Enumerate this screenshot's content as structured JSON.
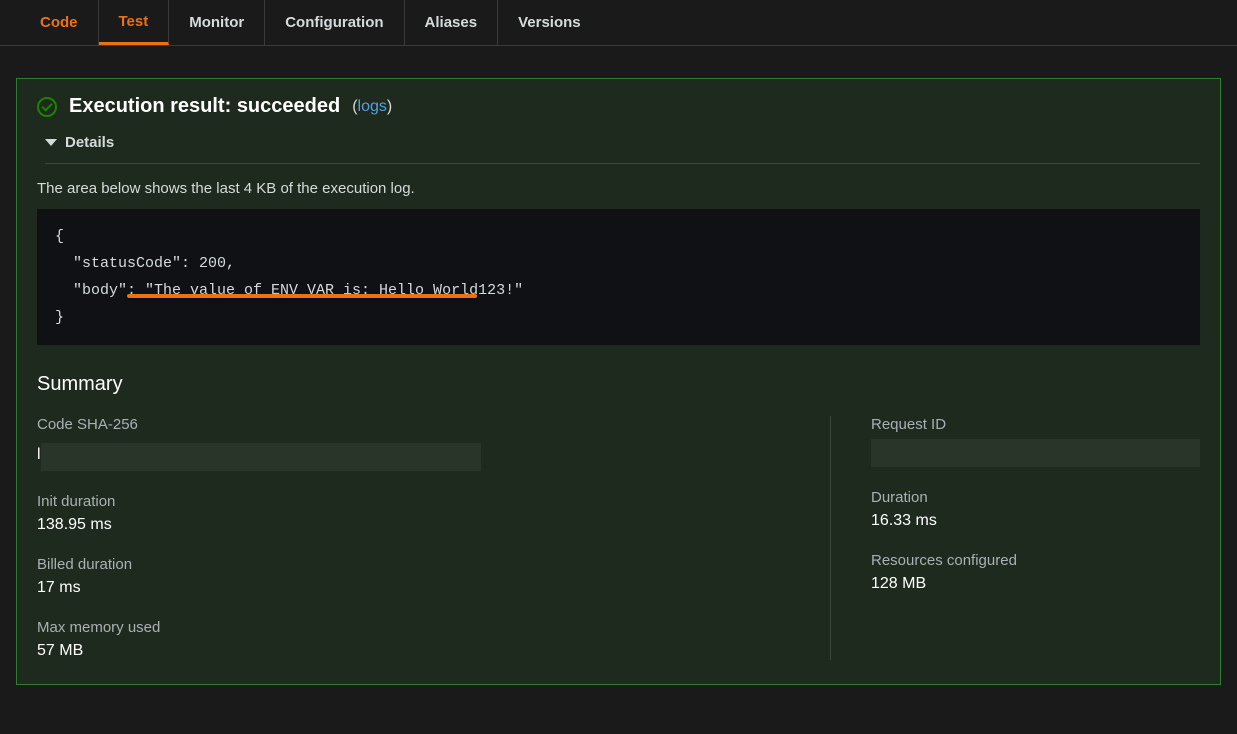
{
  "tabs": {
    "code": "Code",
    "test": "Test",
    "monitor": "Monitor",
    "configuration": "Configuration",
    "aliases": "Aliases",
    "versions": "Versions"
  },
  "result": {
    "title_prefix": "Execution result: ",
    "status": "succeeded",
    "logs_label": "logs",
    "details_label": "Details",
    "log_description": "The area below shows the last 4 KB of the execution log.",
    "code_line1": "{",
    "code_line2": "  \"statusCode\": 200,",
    "code_line3": "  \"body\": \"The value of ENV_VAR is: Hello World123!\"",
    "code_line4": "}"
  },
  "summary": {
    "title": "Summary",
    "code_sha_label": "Code SHA-256",
    "code_sha_value": "l",
    "init_duration_label": "Init duration",
    "init_duration_value": "138.95 ms",
    "billed_duration_label": "Billed duration",
    "billed_duration_value": "17 ms",
    "max_memory_label": "Max memory used",
    "max_memory_value": "57 MB",
    "request_id_label": "Request ID",
    "duration_label": "Duration",
    "duration_value": "16.33 ms",
    "resources_label": "Resources configured",
    "resources_value": "128 MB"
  }
}
